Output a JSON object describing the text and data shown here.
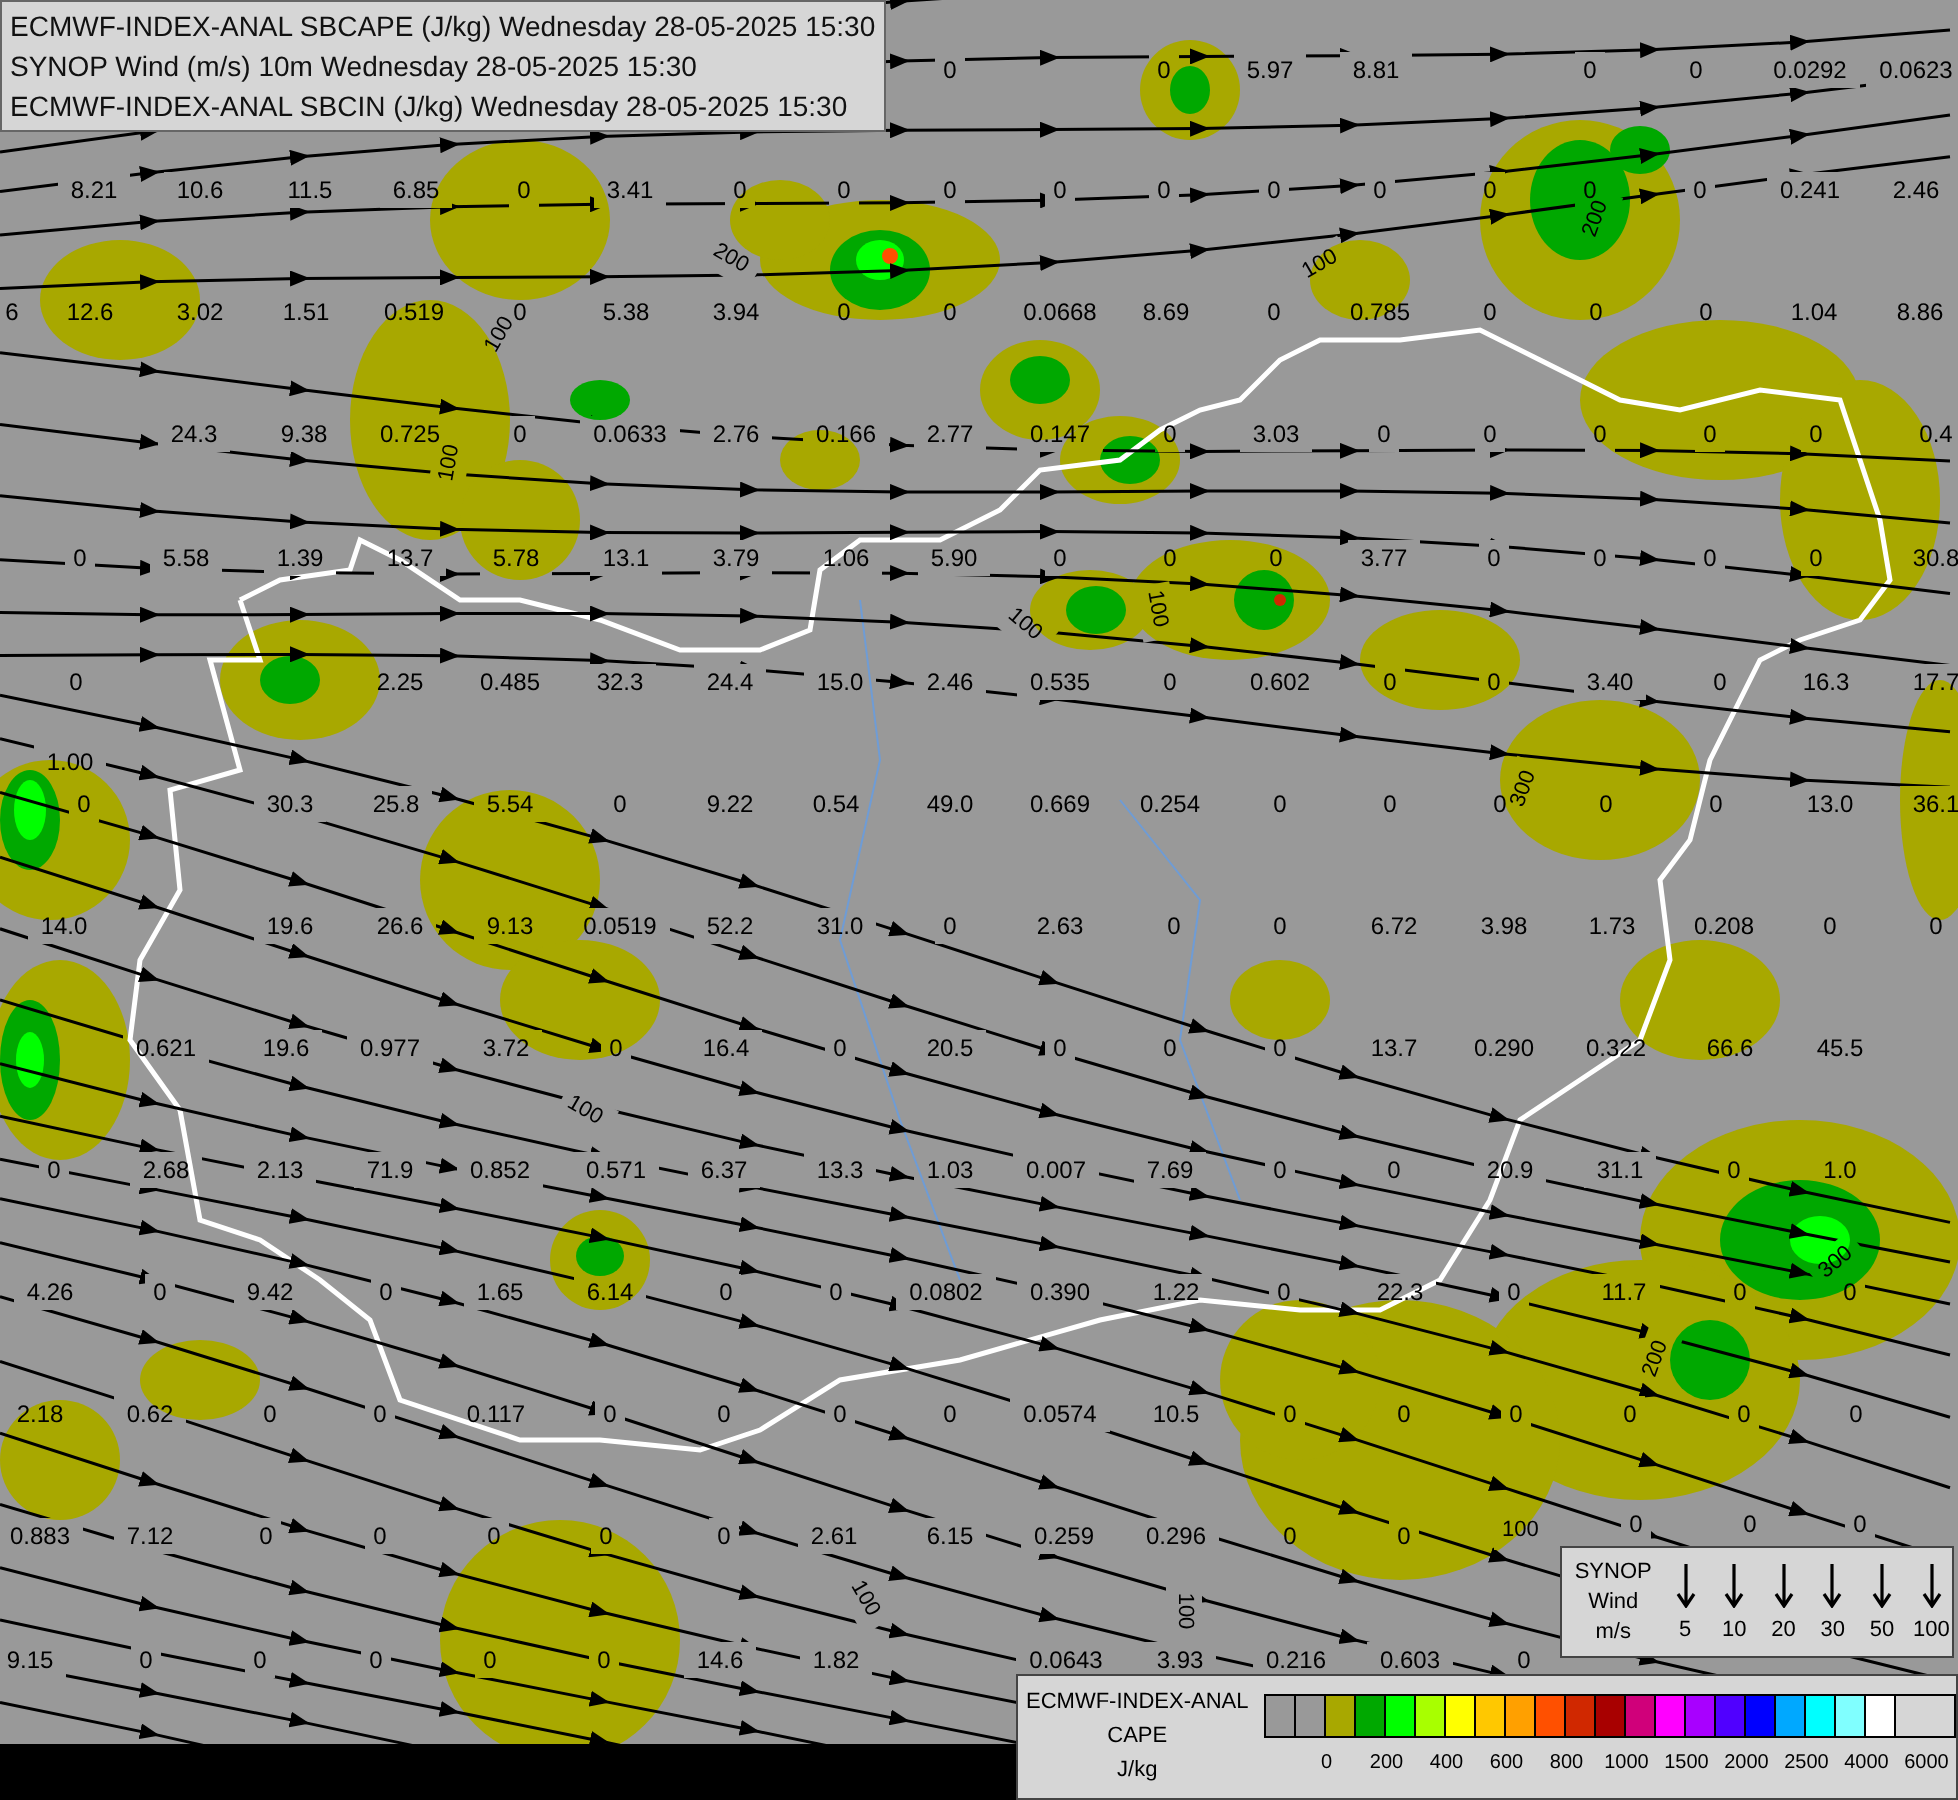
{
  "header": {
    "lines": [
      "ECMWF-INDEX-ANAL SBCAPE (J/kg) Wednesday 28-05-2025 15:30",
      "SYNOP Wind (m/s) 10m Wednesday 28-05-2025 15:30",
      "ECMWF-INDEX-ANAL SBCIN (J/kg) Wednesday 28-05-2025 15:30"
    ]
  },
  "map_values": [
    "0",
    "0",
    "5.97",
    "8.81",
    "0",
    "0",
    "0.0292",
    "0.0623",
    "8.21",
    "10.6",
    "11.5",
    "6.85",
    "0",
    "3.41",
    "0",
    "0",
    "0",
    "0",
    "0",
    "0",
    "0",
    "0",
    "0",
    "0",
    "0.241",
    "2.46",
    "6",
    "12.6",
    "3.02",
    "1.51",
    "0.519",
    "0",
    "5.38",
    "3.94",
    "0",
    "0",
    "0.0668",
    "8.69",
    "0",
    "0.785",
    "0",
    "0",
    "0",
    "1.04",
    "8.86",
    "24.3",
    "9.38",
    "0.725",
    "0",
    "0.0633",
    "2.76",
    "0.166",
    "2.77",
    "0.147",
    "0",
    "3.03",
    "0",
    "0",
    "0",
    "0",
    "0",
    "0.4",
    "0",
    "5.58",
    "1.39",
    "13.7",
    "5.78",
    "13.1",
    "3.79",
    "1.06",
    "5.90",
    "0",
    "0",
    "0",
    "3.77",
    "0",
    "0",
    "0",
    "0",
    "30.8",
    "0",
    "2.25",
    "0.485",
    "32.3",
    "24.4",
    "15.0",
    "2.46",
    "0.535",
    "0",
    "0.602",
    "0",
    "0",
    "3.40",
    "0",
    "16.3",
    "17.7",
    "1.00",
    "0",
    "30.3",
    "25.8",
    "5.54",
    "0",
    "9.22",
    "0.54",
    "49.0",
    "0.669",
    "0.254",
    "0",
    "0",
    "0",
    "0",
    "0",
    "13.0",
    "36.1",
    "14.0",
    "19.6",
    "26.6",
    "9.13",
    "0.0519",
    "52.2",
    "31.0",
    "0",
    "2.63",
    "0",
    "0",
    "6.72",
    "3.98",
    "1.73",
    "0.208",
    "0",
    "0",
    "0.621",
    "19.6",
    "0.977",
    "3.72",
    "0",
    "16.4",
    "0",
    "20.5",
    "0",
    "0",
    "0",
    "13.7",
    "0.290",
    "0.322",
    "66.6",
    "45.5",
    "0",
    "2.68",
    "2.13",
    "71.9",
    "0.852",
    "0.571",
    "6.37",
    "13.3",
    "1.03",
    "0.007",
    "7.69",
    "0",
    "0",
    "20.9",
    "31.1",
    "0",
    "1.0",
    "4.26",
    "0",
    "9.42",
    "0",
    "1.65",
    "6.14",
    "0",
    "0",
    "0.0802",
    "0.390",
    "1.22",
    "0",
    "22.3",
    "0",
    "11.7",
    "0",
    "0",
    "2.18",
    "0.62",
    "0",
    "0",
    "0.117",
    "0",
    "0",
    "0",
    "0",
    "0.0574",
    "10.5",
    "0",
    "0",
    "0",
    "0",
    "0",
    "0",
    "0.883",
    "7.12",
    "0",
    "0",
    "0",
    "0",
    "0",
    "2.61",
    "6.15",
    "0.259",
    "0.296",
    "0",
    "0",
    "0",
    "0",
    "0",
    "9.15",
    "0",
    "0",
    "0",
    "0",
    "0",
    "14.6",
    "1.82",
    "0.0643",
    "3.93",
    "0.216",
    "0.603",
    "0"
  ],
  "contour_labels": [
    "200",
    "100",
    "100",
    "100",
    "200",
    "100",
    "100",
    "300",
    "100",
    "300",
    "200",
    "100",
    "100",
    "100"
  ],
  "synop_legend": {
    "title": [
      "SYNOP",
      "Wind",
      "m/s"
    ],
    "speeds": [
      "5",
      "10",
      "20",
      "30",
      "50",
      "100"
    ]
  },
  "cape_legend": {
    "title": [
      "ECMWF-INDEX-ANAL",
      "CAPE",
      "J/kg"
    ],
    "swatches": [
      {
        "color": "#999999"
      },
      {
        "color": "#999999"
      },
      {
        "color": "#a8a800"
      },
      {
        "color": "#00a800"
      },
      {
        "color": "#00ff00"
      },
      {
        "color": "#a8ff00"
      },
      {
        "color": "#ffff00"
      },
      {
        "color": "#ffc800"
      },
      {
        "color": "#ffa000"
      },
      {
        "color": "#ff5000"
      },
      {
        "color": "#d02800"
      },
      {
        "color": "#a80000"
      },
      {
        "color": "#d0007a"
      },
      {
        "color": "#ff00ff"
      },
      {
        "color": "#a800ff"
      },
      {
        "color": "#5000ff"
      },
      {
        "color": "#0000ff"
      },
      {
        "color": "#00a8ff"
      },
      {
        "color": "#00ffff"
      },
      {
        "color": "#80ffff"
      },
      {
        "color": "#ffffff"
      }
    ],
    "ticks": [
      "0",
      "200",
      "400",
      "600",
      "800",
      "1000",
      "1500",
      "2000",
      "2500",
      "4000",
      "6000"
    ]
  }
}
